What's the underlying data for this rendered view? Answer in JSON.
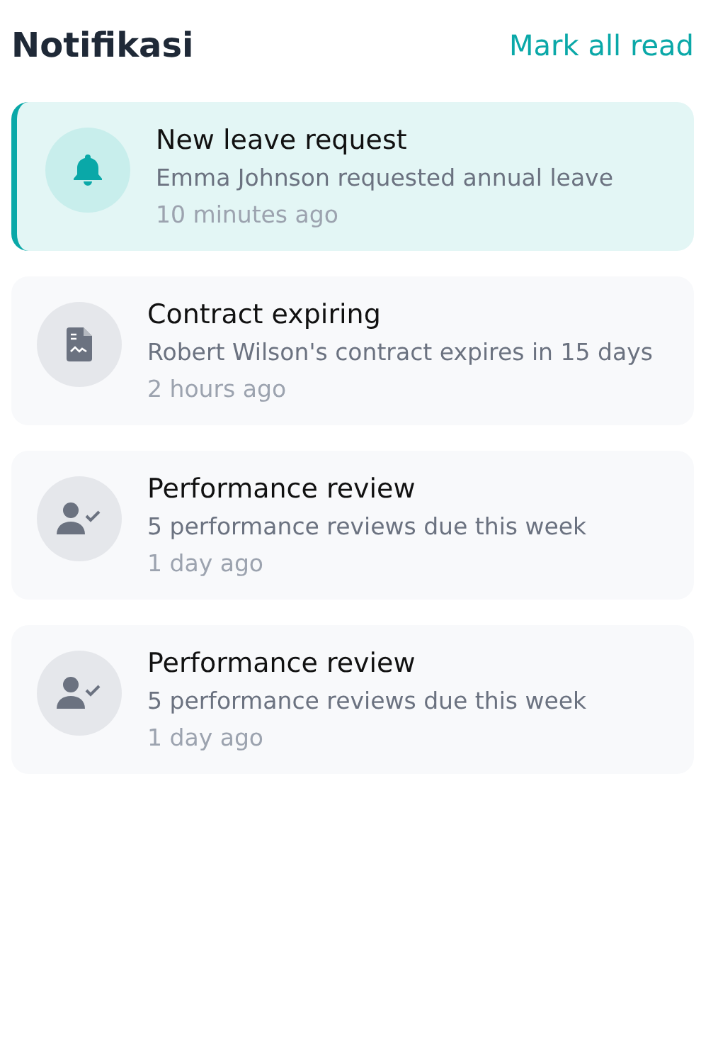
{
  "header": {
    "title": "Notifikasi",
    "action": "Mark all read"
  },
  "notifications": [
    {
      "kind": "bell",
      "title": "New leave request",
      "message": "Emma Johnson requested annual leave",
      "time": "10 minutes ago",
      "unread": true
    },
    {
      "kind": "document",
      "title": "Contract expiring",
      "message": "Robert Wilson's contract expires in 15 days",
      "time": "2 hours ago",
      "unread": false
    },
    {
      "kind": "user-check",
      "title": "Performance review",
      "message": "5 performance reviews due this week",
      "time": "1 day ago",
      "unread": false
    },
    {
      "kind": "user-check",
      "title": "Performance review",
      "message": "5 performance reviews due this week",
      "time": "1 day ago",
      "unread": false
    }
  ]
}
